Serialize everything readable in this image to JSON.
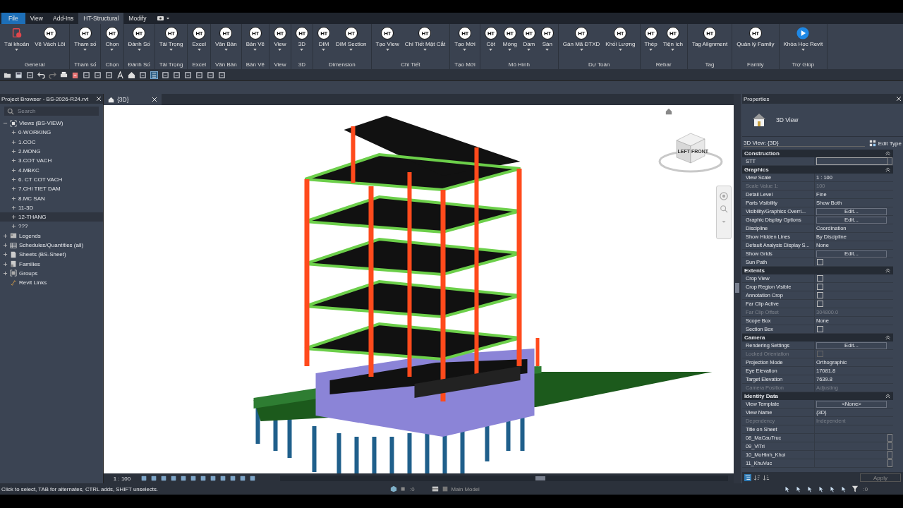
{
  "menu_tabs": [
    {
      "label": "File",
      "kind": "app",
      "selected": false
    },
    {
      "label": "View",
      "kind": "tab",
      "selected": false
    },
    {
      "label": "Add-Ins",
      "kind": "tab",
      "selected": false
    },
    {
      "label": "HT-Structural",
      "kind": "tab",
      "selected": true
    },
    {
      "label": "Modify",
      "kind": "tab",
      "selected": false
    }
  ],
  "ribbon_groups": [
    {
      "title": "General",
      "buttons": [
        {
          "label": "Tài khoản",
          "kind": "account",
          "dropdown": true
        },
        {
          "label": "Vẽ Vách Lõi",
          "kind": "ht",
          "icon_text": "HT",
          "dropdown": false
        }
      ]
    },
    {
      "title": "Tham số",
      "buttons": [
        {
          "label": "Tham số",
          "kind": "ht",
          "icon_text": "HT",
          "dropdown": true
        }
      ]
    },
    {
      "title": "Chọn",
      "buttons": [
        {
          "label": "Chọn",
          "kind": "ht",
          "icon_text": "HT",
          "dropdown": true
        }
      ]
    },
    {
      "title": "Đánh Số",
      "buttons": [
        {
          "label": "Đánh Số",
          "kind": "ht",
          "icon_text": "HT",
          "dropdown": true
        }
      ]
    },
    {
      "title": "Tải Trọng",
      "buttons": [
        {
          "label": "Tải Trọng",
          "kind": "ht",
          "icon_text": "HT",
          "dropdown": true
        }
      ]
    },
    {
      "title": "Excel",
      "buttons": [
        {
          "label": "Excel",
          "kind": "ht",
          "icon_text": "HT",
          "dropdown": true
        }
      ]
    },
    {
      "title": "Văn Bản",
      "buttons": [
        {
          "label": "Văn Bản",
          "kind": "ht",
          "icon_text": "HT",
          "dropdown": true
        }
      ]
    },
    {
      "title": "Bản Vẽ",
      "buttons": [
        {
          "label": "Bản Vẽ",
          "kind": "ht",
          "icon_text": "HT",
          "dropdown": true
        }
      ]
    },
    {
      "title": "View",
      "buttons": [
        {
          "label": "View",
          "kind": "ht",
          "icon_text": "HT",
          "dropdown": true
        }
      ]
    },
    {
      "title": "3D",
      "buttons": [
        {
          "label": "3D",
          "kind": "ht",
          "icon_text": "HT",
          "dropdown": true
        }
      ]
    },
    {
      "title": "Dimension",
      "buttons": [
        {
          "label": "DIM",
          "kind": "ht",
          "icon_text": "HT",
          "dropdown": true
        },
        {
          "label": "DIM Section",
          "kind": "ht",
          "icon_text": "HT",
          "dropdown": true
        }
      ]
    },
    {
      "title": "Chi Tiết",
      "buttons": [
        {
          "label": "Tạo View",
          "kind": "ht",
          "icon_text": "HT",
          "dropdown": true
        },
        {
          "label": "Chi Tiết Mặt Cắt",
          "kind": "ht",
          "icon_text": "HT",
          "dropdown": true
        }
      ]
    },
    {
      "title": "Tạo Mới",
      "buttons": [
        {
          "label": "Tạo Mới",
          "kind": "ht",
          "icon_text": "HT",
          "dropdown": true
        }
      ]
    },
    {
      "title": "Mô Hình",
      "buttons": [
        {
          "label": "Cột",
          "kind": "ht",
          "icon_text": "HT",
          "dropdown": true
        },
        {
          "label": "Móng",
          "kind": "ht",
          "icon_text": "HT",
          "dropdown": true
        },
        {
          "label": "Dầm",
          "kind": "ht",
          "icon_text": "HT",
          "dropdown": true
        },
        {
          "label": "Sàn",
          "kind": "ht",
          "icon_text": "HT",
          "dropdown": true
        }
      ]
    },
    {
      "title": "Dự Toán",
      "buttons": [
        {
          "label": "Gán Mã ĐTXD",
          "kind": "ht",
          "icon_text": "HT",
          "dropdown": true
        },
        {
          "label": "Khối Lượng",
          "kind": "ht",
          "icon_text": "HT",
          "dropdown": true
        }
      ]
    },
    {
      "title": "Rebar",
      "buttons": [
        {
          "label": "Thép",
          "kind": "ht",
          "icon_text": "HT",
          "dropdown": true
        },
        {
          "label": "Tiện ích",
          "kind": "ht",
          "icon_text": "HT",
          "dropdown": true
        }
      ]
    },
    {
      "title": "Tag",
      "buttons": [
        {
          "label": "Tag Alignment",
          "kind": "ht",
          "icon_text": "HT",
          "dropdown": false
        }
      ]
    },
    {
      "title": "Family",
      "buttons": [
        {
          "label": "Quản lý Family",
          "kind": "ht",
          "icon_text": "HT",
          "dropdown": false
        }
      ]
    },
    {
      "title": "Trợ Giúp",
      "buttons": [
        {
          "label": "Khóa Học Revit",
          "kind": "play",
          "dropdown": true
        }
      ]
    }
  ],
  "project_browser": {
    "title": "Project Browser - BS-2026-R24.rvt",
    "search": {
      "placeholder": "Search"
    },
    "tree": [
      {
        "label": "Views (BS-VIEW)",
        "kind": "views",
        "expanded": true,
        "selected": false,
        "children": [
          {
            "label": "0-WORKING",
            "expanded": false,
            "selected": false
          },
          {
            "label": "1.COC",
            "expanded": false,
            "selected": false
          },
          {
            "label": "2.MONG",
            "expanded": false,
            "selected": false
          },
          {
            "label": "3.COT VACH",
            "expanded": false,
            "selected": false
          },
          {
            "label": "4.MBKC",
            "expanded": false,
            "selected": false
          },
          {
            "label": "6. CT COT VACH",
            "expanded": false,
            "selected": false
          },
          {
            "label": "7.CHI TIET DAM",
            "expanded": false,
            "selected": false
          },
          {
            "label": "8.MC SAN",
            "expanded": false,
            "selected": false
          },
          {
            "label": "11-3D",
            "expanded": false,
            "selected": false
          },
          {
            "label": "12-THANG",
            "expanded": false,
            "selected": true
          },
          {
            "label": "???",
            "expanded": false,
            "selected": false
          }
        ]
      },
      {
        "label": "Legends",
        "kind": "legends",
        "expanded": false,
        "selected": false
      },
      {
        "label": "Schedules/Quantities (all)",
        "kind": "schedules",
        "expanded": false,
        "selected": false
      },
      {
        "label": "Sheets (BS-Sheet)",
        "kind": "sheets",
        "expanded": false,
        "selected": false
      },
      {
        "label": "Families",
        "kind": "families",
        "expanded": false,
        "selected": false
      },
      {
        "label": "Groups",
        "kind": "groups",
        "expanded": false,
        "selected": false
      },
      {
        "label": "Revit Links",
        "kind": "links",
        "selected": false
      }
    ]
  },
  "view": {
    "tab": "{3D}",
    "cube_faces": [
      "LEFT",
      "FRONT"
    ],
    "scale": "1 : 100"
  },
  "properties": {
    "title": "Properties",
    "type_name": "3D View",
    "selector": "3D View: {3D}",
    "edit_type": "Edit Type",
    "sections": [
      {
        "title": "Construction",
        "rows": [
          {
            "name": "STT",
            "kind": "field",
            "disabled": false
          }
        ]
      },
      {
        "title": "Graphics",
        "rows": [
          {
            "name": "View Scale",
            "kind": "text",
            "value": "1 : 100",
            "disabled": false
          },
          {
            "name": "Scale Value    1:",
            "kind": "text",
            "value": "100",
            "disabled": true
          },
          {
            "name": "Detail Level",
            "kind": "text",
            "value": "Fine",
            "disabled": false
          },
          {
            "name": "Parts Visibility",
            "kind": "text",
            "value": "Show Both",
            "disabled": false
          },
          {
            "name": "Visibility/Graphics Overri...",
            "kind": "button",
            "value": "Edit...",
            "disabled": false
          },
          {
            "name": "Graphic Display Options",
            "kind": "button",
            "value": "Edit...",
            "disabled": false
          },
          {
            "name": "Discipline",
            "kind": "text",
            "value": "Coordination",
            "disabled": false
          },
          {
            "name": "Show Hidden Lines",
            "kind": "text",
            "value": "By Discipline",
            "disabled": false
          },
          {
            "name": "Default Analysis Display S...",
            "kind": "text",
            "value": "None",
            "disabled": false
          },
          {
            "name": "Show Grids",
            "kind": "button",
            "value": "Edit...",
            "disabled": false
          },
          {
            "name": "Sun Path",
            "kind": "checkbox",
            "checked": false,
            "disabled": false
          }
        ]
      },
      {
        "title": "Extents",
        "rows": [
          {
            "name": "Crop View",
            "kind": "checkbox",
            "checked": false,
            "disabled": false
          },
          {
            "name": "Crop Region Visible",
            "kind": "checkbox",
            "checked": false,
            "disabled": false
          },
          {
            "name": "Annotation Crop",
            "kind": "checkbox",
            "checked": false,
            "disabled": false
          },
          {
            "name": "Far Clip Active",
            "kind": "checkbox",
            "checked": false,
            "disabled": false
          },
          {
            "name": "Far Clip Offset",
            "kind": "text",
            "value": "304800.0",
            "disabled": true
          },
          {
            "name": "Scope Box",
            "kind": "text",
            "value": "None",
            "disabled": false
          },
          {
            "name": "Section Box",
            "kind": "checkbox",
            "checked": false,
            "disabled": false
          }
        ]
      },
      {
        "title": "Camera",
        "rows": [
          {
            "name": "Rendering Settings",
            "kind": "button",
            "value": "Edit...",
            "disabled": false
          },
          {
            "name": "Locked Orientation",
            "kind": "checkbox",
            "checked": false,
            "disabled": true
          },
          {
            "name": "Projection Mode",
            "kind": "text",
            "value": "Orthographic",
            "disabled": false
          },
          {
            "name": "Eye Elevation",
            "kind": "text",
            "value": "17081.8",
            "disabled": false
          },
          {
            "name": "Target Elevation",
            "kind": "text",
            "value": "7639.8",
            "disabled": false
          },
          {
            "name": "Camera Position",
            "kind": "text",
            "value": "Adjusting",
            "disabled": true
          }
        ]
      },
      {
        "title": "Identity Data",
        "rows": [
          {
            "name": "View Template",
            "kind": "button",
            "value": "<None>",
            "disabled": false
          },
          {
            "name": "View Name",
            "kind": "text",
            "value": "{3D}",
            "disabled": false
          },
          {
            "name": "Dependency",
            "kind": "text",
            "value": "Independent",
            "disabled": true
          },
          {
            "name": "Title on Sheet",
            "kind": "text",
            "disabled": false
          },
          {
            "name": "08_MaCauTruc",
            "kind": "field",
            "disabled": false
          },
          {
            "name": "09_ViTri",
            "kind": "field",
            "disabled": false
          },
          {
            "name": "10_MoHinh_Khoi",
            "kind": "field",
            "disabled": false
          },
          {
            "name": "11_KhuVuc",
            "kind": "field",
            "disabled": false
          }
        ]
      }
    ],
    "apply": "Apply"
  },
  "status_bar": {
    "hint": "Click to select, TAB for alternates, CTRL adds, SHIFT unselects.",
    "workset": ":0",
    "model": "Main Model",
    "filter": ":0"
  }
}
